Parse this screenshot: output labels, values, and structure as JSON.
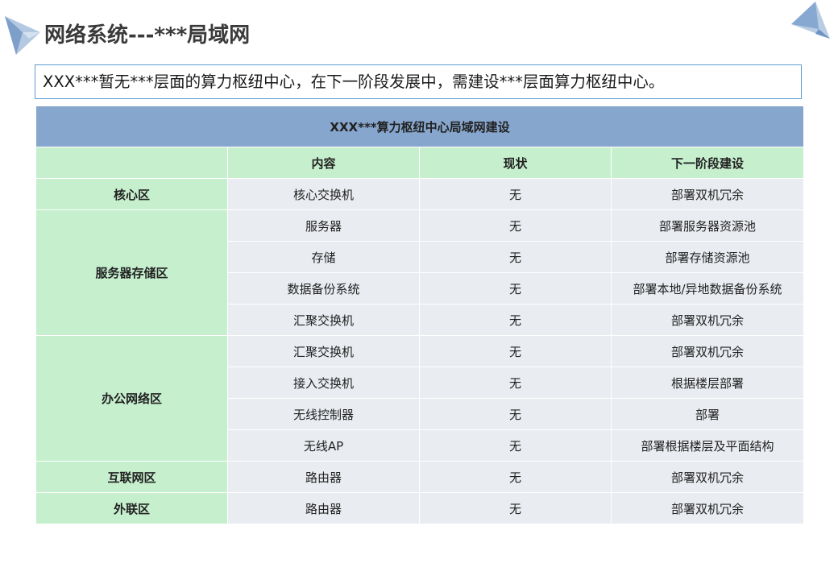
{
  "page": {
    "title": "网络系统---***局域网",
    "summary": "XXX***暂无***层面的算力枢纽中心，在下一阶段发展中，需建设***层面算力枢纽中心。"
  },
  "table": {
    "title": "XXX***算力枢纽中心局域网建设",
    "headers": [
      "",
      "内容",
      "现状",
      "下一阶段建设"
    ],
    "zones": [
      {
        "name": "核心区",
        "rows": [
          {
            "content": "核心交换机",
            "status": "无",
            "next": "部署双机冗余"
          }
        ]
      },
      {
        "name": "服务器存储区",
        "rows": [
          {
            "content": "服务器",
            "status": "无",
            "next": "部署服务器资源池"
          },
          {
            "content": "存储",
            "status": "无",
            "next": "部署存储资源池"
          },
          {
            "content": "数据备份系统",
            "status": "无",
            "next": "部署本地/异地数据备份系统"
          },
          {
            "content": "汇聚交换机",
            "status": "无",
            "next": "部署双机冗余"
          }
        ]
      },
      {
        "name": "办公网络区",
        "rows": [
          {
            "content": "汇聚交换机",
            "status": "无",
            "next": "部署双机冗余"
          },
          {
            "content": "接入交换机",
            "status": "无",
            "next": "根据楼层部署"
          },
          {
            "content": "无线控制器",
            "status": "无",
            "next": "部署"
          },
          {
            "content": "无线AP",
            "status": "无",
            "next": "部署根据楼层及平面结构"
          }
        ]
      },
      {
        "name": "互联网区",
        "rows": [
          {
            "content": "路由器",
            "status": "无",
            "next": "部署双机冗余"
          }
        ]
      },
      {
        "name": "外联区",
        "rows": [
          {
            "content": "路由器",
            "status": "无",
            "next": "部署双机冗余"
          }
        ]
      }
    ]
  },
  "colors": {
    "title_bar": "#86a6cd",
    "zone_fill": "#c6efce",
    "cell_fill": "#e9ecf1",
    "box_border": "#5a9fd4"
  },
  "icons": {
    "top_left": "paper-plane-decoration",
    "top_right": "paper-plane-decoration"
  }
}
